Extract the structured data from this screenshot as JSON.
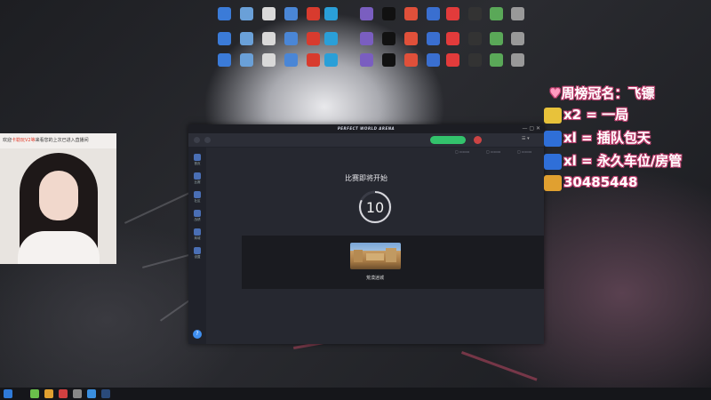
{
  "desktop_icons": [
    {
      "name": "computer-icon",
      "label": "",
      "color": "#3b7bd8"
    },
    {
      "name": "recycle-bin-icon",
      "label": "",
      "color": "#6aa0d8"
    },
    {
      "name": "app-icon",
      "label": "",
      "color": "#d9d9d9"
    },
    {
      "name": "app-icon",
      "label": "",
      "color": "#4a86d6"
    },
    {
      "name": "app-icon",
      "label": "WPS Office",
      "color": "#d83b2e"
    },
    {
      "name": "app-icon",
      "label": "",
      "color": "#2a9fd8"
    },
    {
      "name": "app-icon",
      "label": "",
      "color": "#7a5ec0"
    },
    {
      "name": "app-icon",
      "label": "",
      "color": "#111111"
    },
    {
      "name": "app-icon",
      "label": "",
      "color": "#e0503a"
    },
    {
      "name": "app-icon",
      "label": "",
      "color": "#3a6fd0"
    },
    {
      "name": "app-icon",
      "label": "",
      "color": "#e23b3b"
    },
    {
      "name": "app-icon",
      "label": "",
      "color": "#333333"
    },
    {
      "name": "app-icon",
      "label": "",
      "color": "#5aa858"
    },
    {
      "name": "app-icon",
      "label": "",
      "color": "#999999"
    }
  ],
  "app": {
    "title": "PERFECT WORLD ARENA",
    "window_controls": "— ▢ ✕",
    "username": "",
    "sidebar": [
      {
        "label": "首页",
        "icon": "home-icon"
      },
      {
        "label": "比赛",
        "icon": "match-icon"
      },
      {
        "label": "社区",
        "icon": "community-icon"
      },
      {
        "label": "战绩",
        "icon": "stats-icon"
      },
      {
        "label": "商城",
        "icon": "shop-icon"
      },
      {
        "label": "设置",
        "icon": "settings-icon"
      }
    ],
    "match_title": "比赛即将开始",
    "countdown": "10",
    "map_name": "荒漠迷城"
  },
  "overlay": {
    "line1": "周榜冠名：飞镖",
    "line2": "x2 = 一局",
    "line3": "xl = 插队包天",
    "line4": "xl = 永久车位/房管",
    "line5": "30485448",
    "colors": {
      "line2_icon": "#e8c23a",
      "line3_icon": "#2f6fd8",
      "line4_icon": "#2f6fd8",
      "line5_icon": "#e0a030"
    }
  },
  "webcam": {
    "banner_prefix": "欢迎",
    "banner_highlight": "卡勒玩V2等",
    "banner_suffix": "来看您的上次已进入直播间"
  }
}
